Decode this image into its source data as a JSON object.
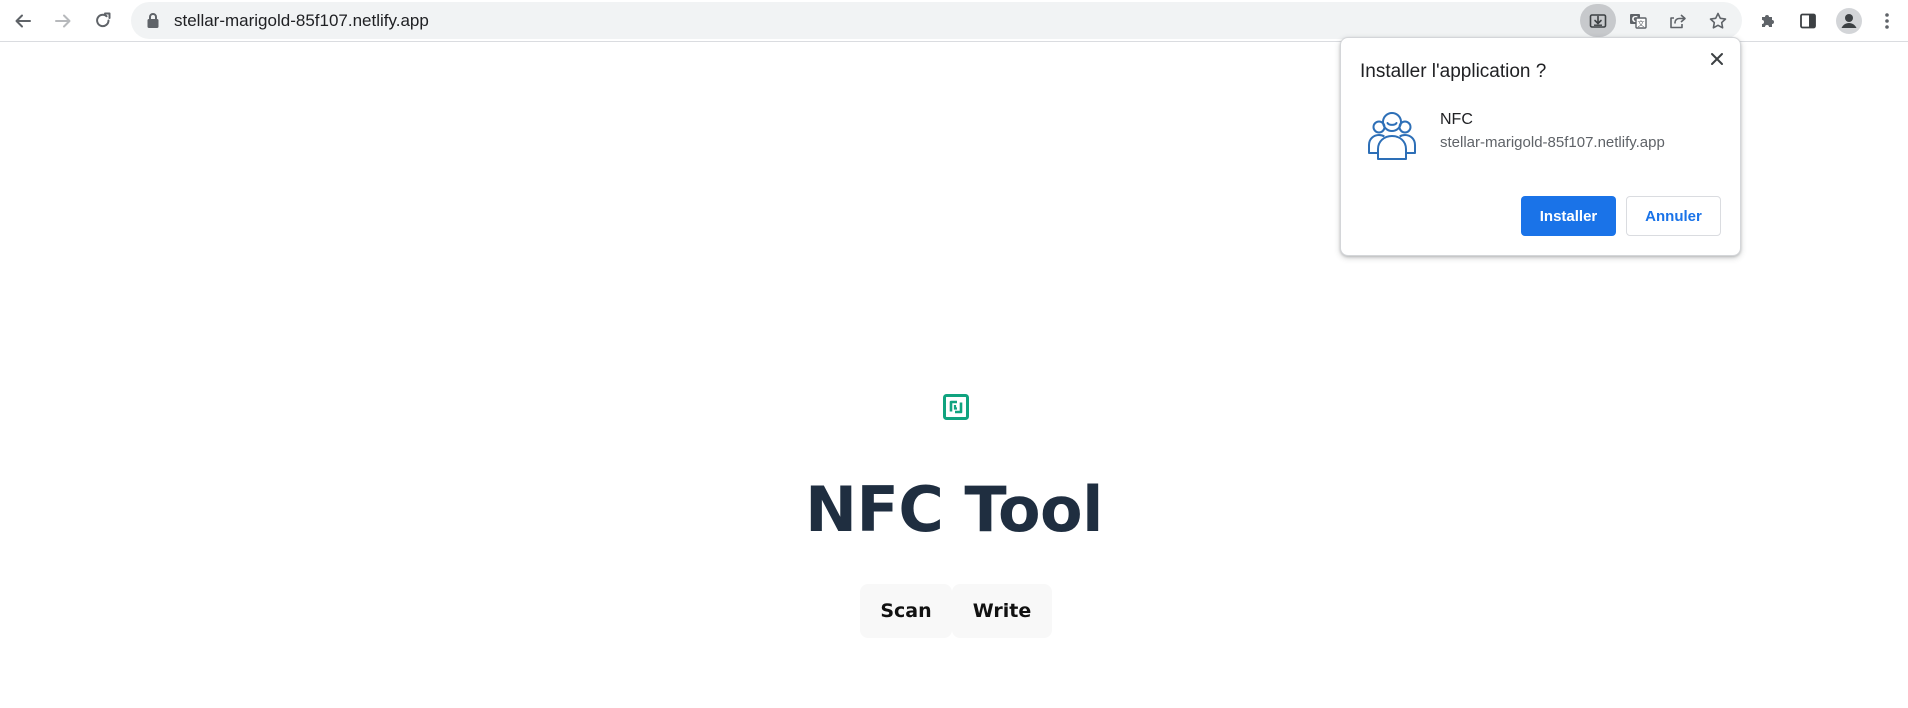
{
  "browser": {
    "url": "stellar-marigold-85f107.netlify.app",
    "icons": {
      "back": "arrow-left-icon",
      "forward": "arrow-right-icon",
      "reload": "reload-icon",
      "lock": "lock-icon",
      "install": "install-app-icon",
      "translate": "translate-icon",
      "share": "share-icon",
      "bookmark": "star-icon",
      "extensions": "puzzle-icon",
      "side_panel": "side-panel-icon",
      "profile": "profile-icon",
      "menu": "kebab-menu-icon"
    }
  },
  "install_dialog": {
    "title": "Installer l'application ?",
    "app_name": "NFC",
    "app_origin": "stellar-marigold-85f107.netlify.app",
    "install_label": "Installer",
    "cancel_label": "Annuler",
    "app_icon": "users-icon"
  },
  "page": {
    "logo_icon": "nfc-icon",
    "title": "NFC Tool",
    "scan_label": "Scan",
    "write_label": "Write"
  },
  "colors": {
    "accent": "#1a73e8",
    "title": "#1f2e40",
    "nfc_logo": "#10a37f"
  }
}
